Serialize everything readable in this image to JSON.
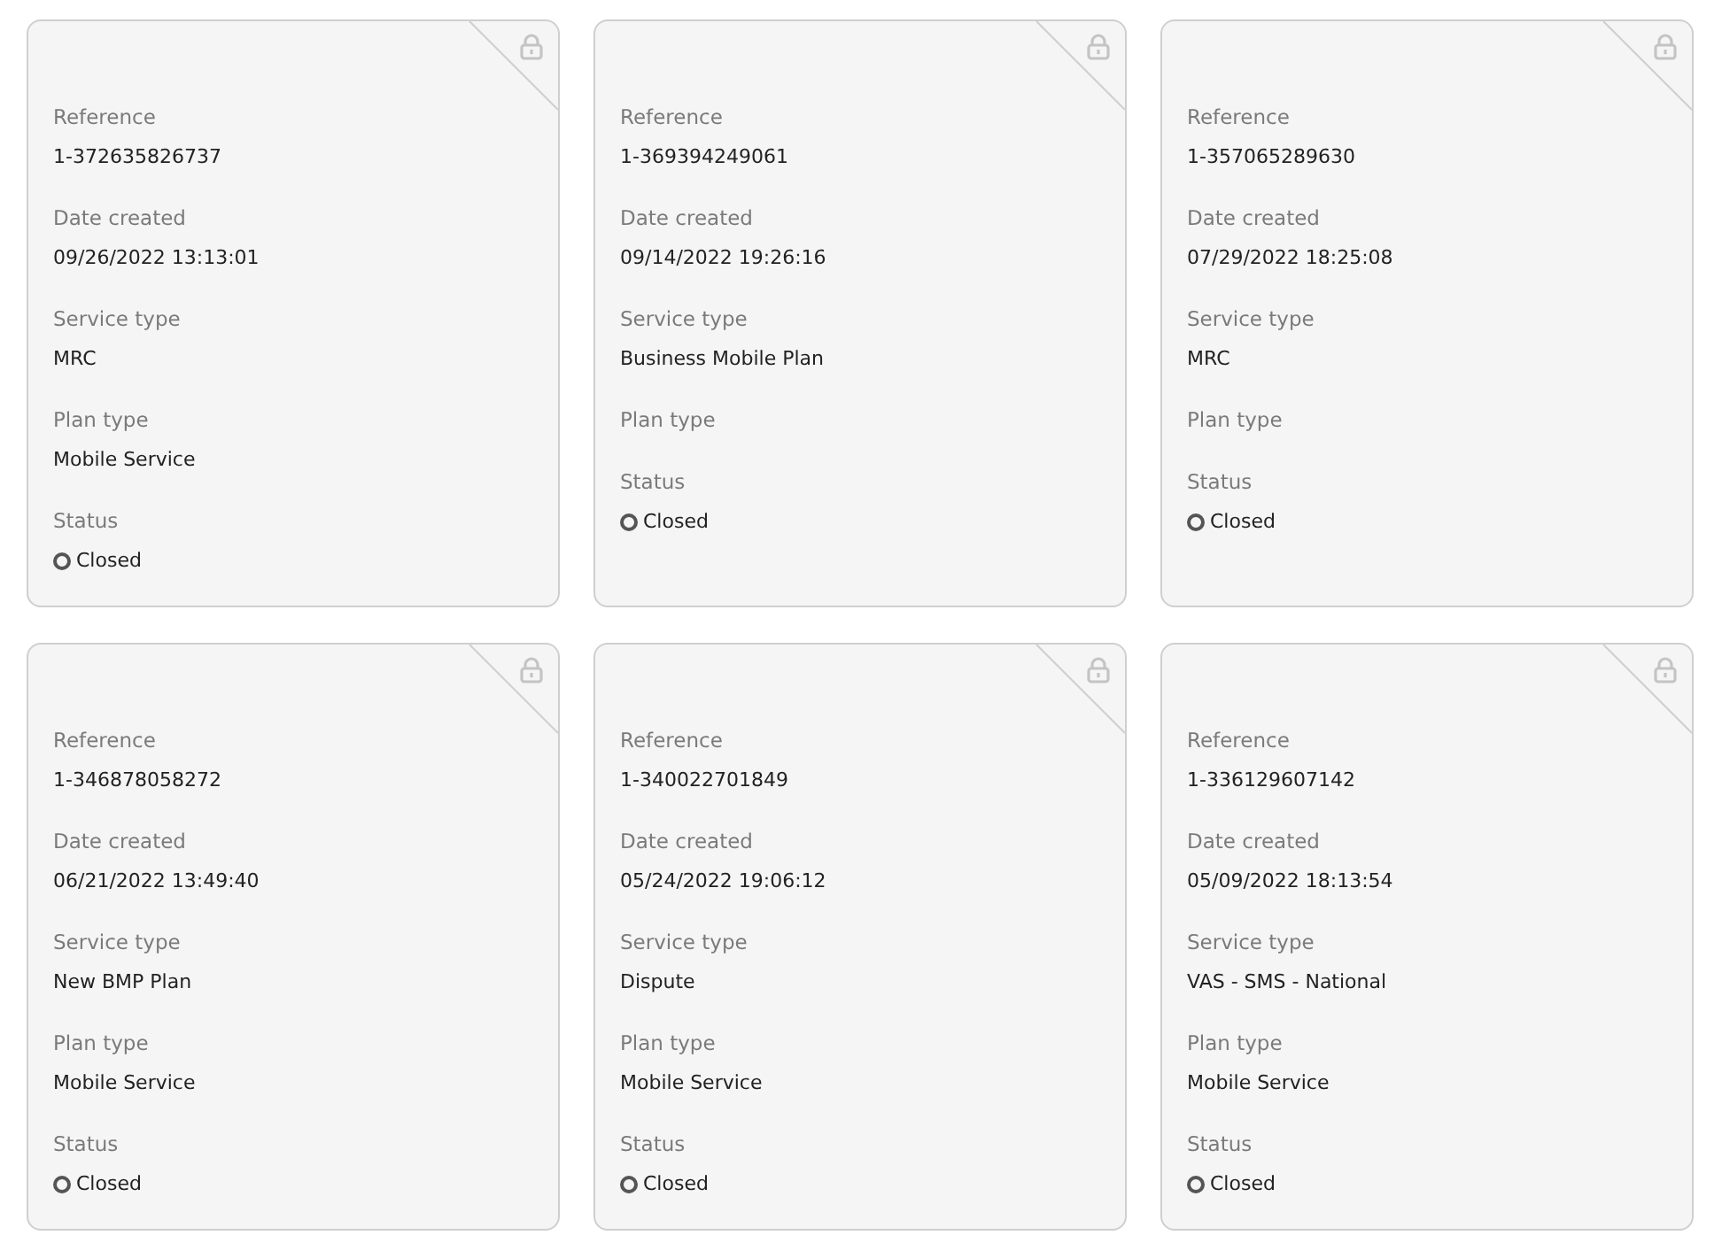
{
  "cards": [
    {
      "locked": true,
      "fields": [
        {
          "label": "Reference",
          "value": "1-372635826737"
        },
        {
          "label": "Date created",
          "value": "09/26/2022 13:13:01"
        },
        {
          "label": "Service type",
          "value": "MRC"
        },
        {
          "label": "Plan type",
          "value": "Mobile Service"
        },
        {
          "label": "Status",
          "value": "Closed",
          "kind": "status"
        }
      ]
    },
    {
      "locked": true,
      "fields": [
        {
          "label": "Reference",
          "value": "1-369394249061"
        },
        {
          "label": "Date created",
          "value": "09/14/2022 19:26:16"
        },
        {
          "label": "Service type",
          "value": "Business Mobile Plan"
        },
        {
          "label": "Plan type"
        },
        {
          "label": "Status",
          "value": "Closed",
          "kind": "status"
        }
      ]
    },
    {
      "locked": true,
      "fields": [
        {
          "label": "Reference",
          "value": "1-357065289630"
        },
        {
          "label": "Date created",
          "value": "07/29/2022 18:25:08"
        },
        {
          "label": "Service type",
          "value": "MRC"
        },
        {
          "label": "Plan type"
        },
        {
          "label": "Status",
          "value": "Closed",
          "kind": "status"
        }
      ]
    },
    {
      "locked": true,
      "fields": [
        {
          "label": "Reference",
          "value": "1-346878058272"
        },
        {
          "label": "Date created",
          "value": "06/21/2022 13:49:40"
        },
        {
          "label": "Service type",
          "value": "New BMP Plan"
        },
        {
          "label": "Plan type",
          "value": "Mobile Service"
        },
        {
          "label": "Status",
          "value": "Closed",
          "kind": "status"
        }
      ]
    },
    {
      "locked": true,
      "fields": [
        {
          "label": "Reference",
          "value": "1-340022701849"
        },
        {
          "label": "Date created",
          "value": "05/24/2022 19:06:12"
        },
        {
          "label": "Service type",
          "value": "Dispute"
        },
        {
          "label": "Plan type",
          "value": "Mobile Service"
        },
        {
          "label": "Status",
          "value": "Closed",
          "kind": "status"
        }
      ]
    },
    {
      "locked": true,
      "fields": [
        {
          "label": "Reference",
          "value": "1-336129607142"
        },
        {
          "label": "Date created",
          "value": "05/09/2022 18:13:54"
        },
        {
          "label": "Service type",
          "value": "VAS - SMS - National"
        },
        {
          "label": "Plan type",
          "value": "Mobile Service"
        },
        {
          "label": "Status",
          "value": "Closed",
          "kind": "status"
        }
      ]
    }
  ]
}
